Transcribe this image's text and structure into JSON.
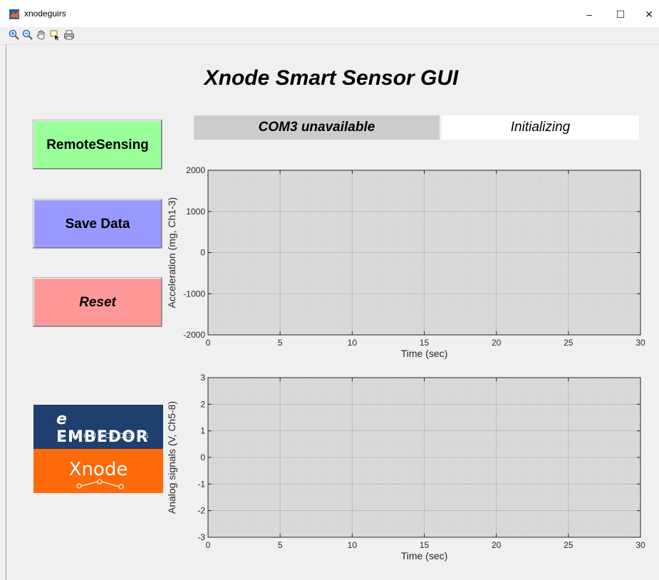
{
  "window": {
    "title": "xnodeguirs",
    "minimize_label": "–",
    "maximize_label": "☐",
    "close_label": "✕"
  },
  "toolbar": {
    "tools": [
      "zoom-in-icon",
      "zoom-out-icon",
      "pan-hand-icon",
      "data-cursor-icon",
      "print-icon"
    ]
  },
  "header": {
    "title": "Xnode Smart Sensor GUI"
  },
  "status": {
    "port": "COM3 unavailable",
    "state": "Initializing"
  },
  "buttons": {
    "remote_sensing": "RemoteSensing",
    "save_data": "Save Data",
    "reset": "Reset"
  },
  "colors": {
    "remote_sensing": "#99ff99",
    "save_data": "#9999ff",
    "reset": "#ff9999",
    "plot_bg": "#d9d9d9",
    "status_port_bg": "#cccccc",
    "logo_top": "#1f3f6e",
    "logo_bottom": "#fe6a0a"
  },
  "logo": {
    "brand_prefix": "e",
    "brand": "EMBEDOR",
    "sub": "TECHNOLOGIES",
    "product": "Xnode"
  },
  "chart_data": [
    {
      "type": "line",
      "title": "",
      "xlabel": "Time (sec)",
      "ylabel": "Acceleration (mg, Ch1-3)",
      "xlim": [
        0,
        30
      ],
      "ylim": [
        -2000,
        2000
      ],
      "xticks": [
        0,
        5,
        10,
        15,
        20,
        25,
        30
      ],
      "yticks": [
        -2000,
        -1000,
        0,
        1000,
        2000
      ],
      "grid": true,
      "minor_grid": true,
      "series": []
    },
    {
      "type": "line",
      "title": "",
      "xlabel": "Time (sec)",
      "ylabel": "Analog signals (V, Ch5-8)",
      "xlim": [
        0,
        30
      ],
      "ylim": [
        -3,
        3
      ],
      "xticks": [
        0,
        5,
        10,
        15,
        20,
        25,
        30
      ],
      "yticks": [
        -3,
        -2,
        -1,
        0,
        1,
        2,
        3
      ],
      "grid": true,
      "minor_grid": true,
      "series": []
    }
  ]
}
